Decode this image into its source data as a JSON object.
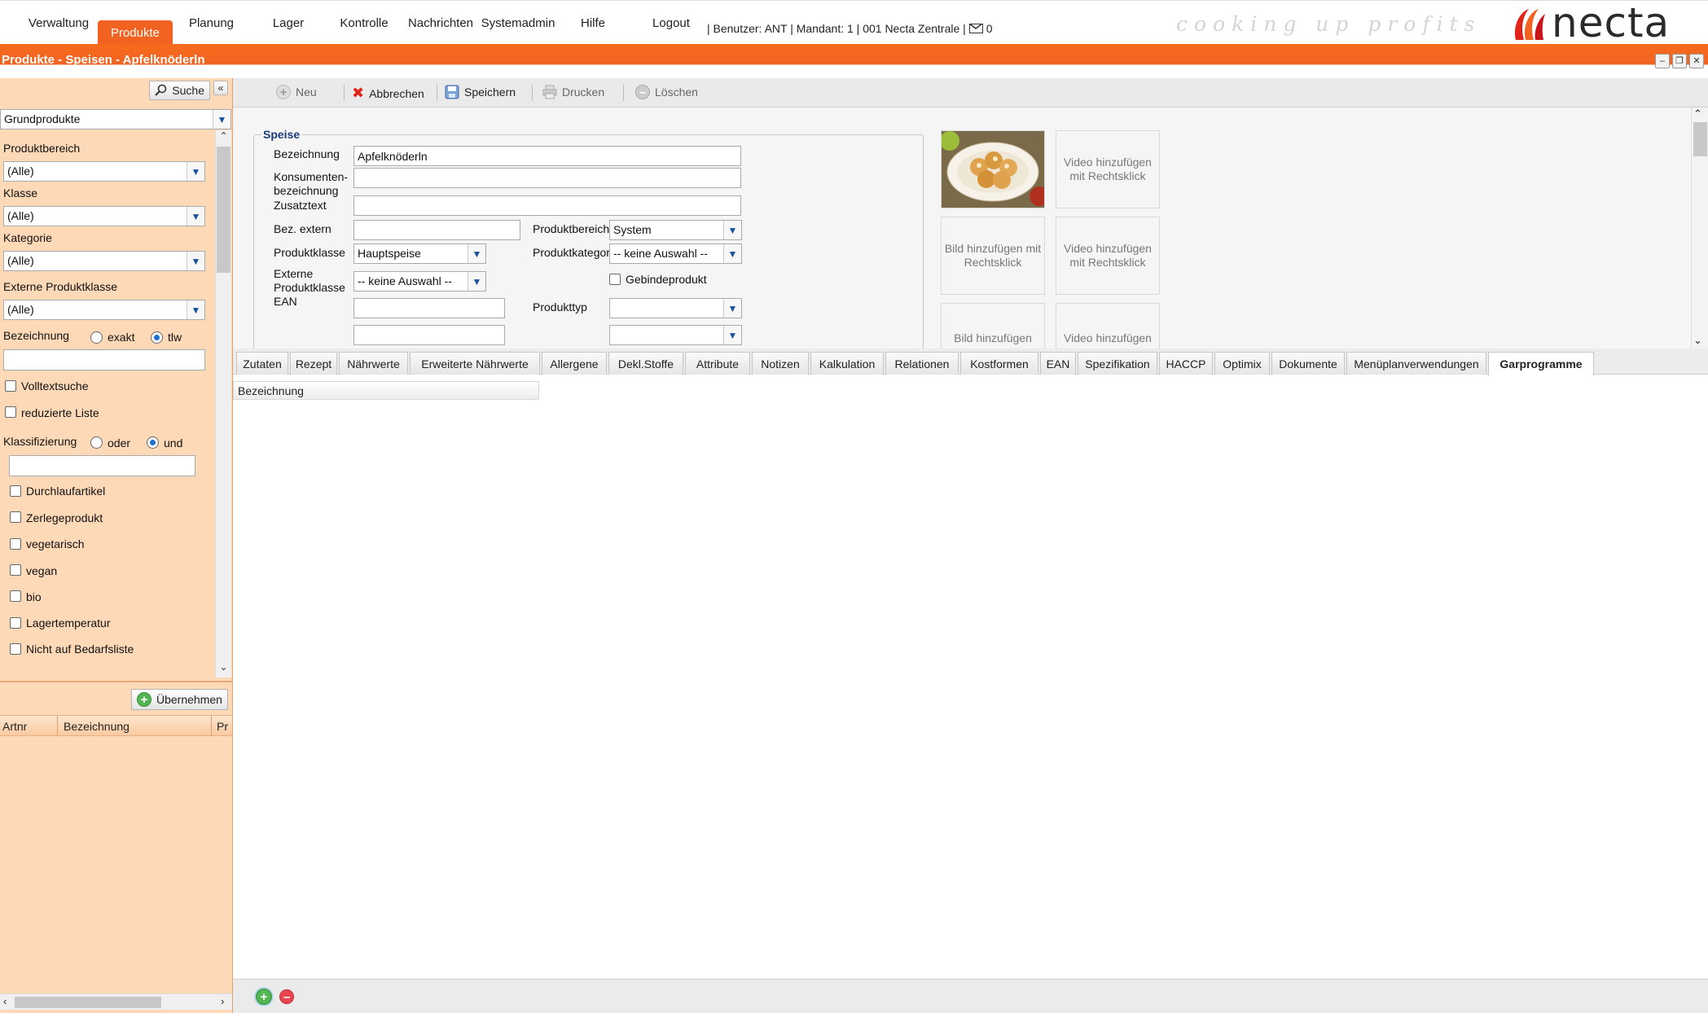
{
  "nav": {
    "items": [
      "Verwaltung",
      "Produkte",
      "Planung",
      "Lager",
      "Kontrolle",
      "Nachrichten",
      "Systemadmin",
      "Hilfe"
    ],
    "active": "Produkte",
    "logout": "Logout",
    "user_info": "| Benutzer: ANT | Mandant: 1 | 001 Necta Zentrale |",
    "messages_count": "0",
    "tagline": "cooking up profits",
    "logo_text": "necta"
  },
  "window": {
    "title": "Produkte - Speisen - Apfelknöderln"
  },
  "left": {
    "search_button": "Suche",
    "product_group": "Grundprodukte",
    "produktbereich_label": "Produktbereich",
    "produktbereich_value": "(Alle)",
    "klasse_label": "Klasse",
    "klasse_value": "(Alle)",
    "kategorie_label": "Kategorie",
    "kategorie_value": "(Alle)",
    "ext_klasse_label": "Externe Produktklasse",
    "ext_klasse_value": "(Alle)",
    "bezeichnung_label": "Bezeichnung",
    "radio_exakt": "exakt",
    "radio_tlw": "tlw",
    "bezeichnung_value": "",
    "volltext": "Volltextsuche",
    "reduziert": "reduzierte Liste",
    "klassifizierung_label": "Klassifizierung",
    "radio_oder": "oder",
    "radio_und": "und",
    "klassifizierung_value": "",
    "checks": [
      "Durchlaufartikel",
      "Zerlegeprodukt",
      "vegetarisch",
      "vegan",
      "bio",
      "Lagertemperatur",
      "Nicht auf Bedarfsliste"
    ],
    "uebernehmen": "Übernehmen",
    "list_headers": [
      "Artnr",
      "Bezeichnung",
      "Pr"
    ]
  },
  "toolbar": {
    "neu": "Neu",
    "abbrechen": "Abbrechen",
    "speichern": "Speichern",
    "drucken": "Drucken",
    "loeschen": "Löschen"
  },
  "form": {
    "legend": "Speise",
    "bezeichnung_label": "Bezeichnung",
    "bezeichnung_value": "Apfelknöderln",
    "konsumenten_label_1": "Konsumenten-",
    "konsumenten_label_2": "bezeichnung",
    "konsumenten_value": "",
    "zusatztext_label": "Zusatztext",
    "zusatztext_value": "",
    "bez_extern_label": "Bez. extern",
    "bez_extern_value": "",
    "produktbereich_label": "Produktbereich",
    "produktbereich_value": "System",
    "produktklasse_label": "Produktklasse",
    "produktklasse_value": "Hauptspeise",
    "produktkategorie_label": "Produktkategorie",
    "produktkategorie_value": "-- keine Auswahl --",
    "ext_produktklasse_label_1": "Externe",
    "ext_produktklasse_label_2": "Produktklasse",
    "ext_produktklasse_value": "-- keine Auswahl --",
    "gebinde_label": "Gebindeprodukt",
    "ean_label": "EAN",
    "ean_value": "",
    "produkttyp_label": "Produkttyp",
    "produkttyp_value": ""
  },
  "media": {
    "video1": "Video hinzufügen mit Rechtsklick",
    "bild2": "Bild hinzufügen mit Rechtsklick",
    "video2": "Video hinzufügen mit Rechtsklick",
    "bild3": "Bild hinzufügen",
    "video3": "Video hinzufügen"
  },
  "tabs": [
    "Zutaten",
    "Rezept",
    "Nährwerte",
    "Erweiterte Nährwerte",
    "Allergene",
    "Dekl.Stoffe",
    "Attribute",
    "Notizen",
    "Kalkulation",
    "Relationen",
    "Kostformen",
    "EAN",
    "Spezifikation",
    "HACCP",
    "Optimix",
    "Dokumente",
    "Menüplanverwendungen",
    "Garprogramme"
  ],
  "active_tab": "Garprogramme",
  "grid": {
    "header": "Bezeichnung"
  },
  "colors": {
    "accent": "#f26322",
    "panel": "#fdd9b8",
    "legend": "#1d3a7a"
  }
}
